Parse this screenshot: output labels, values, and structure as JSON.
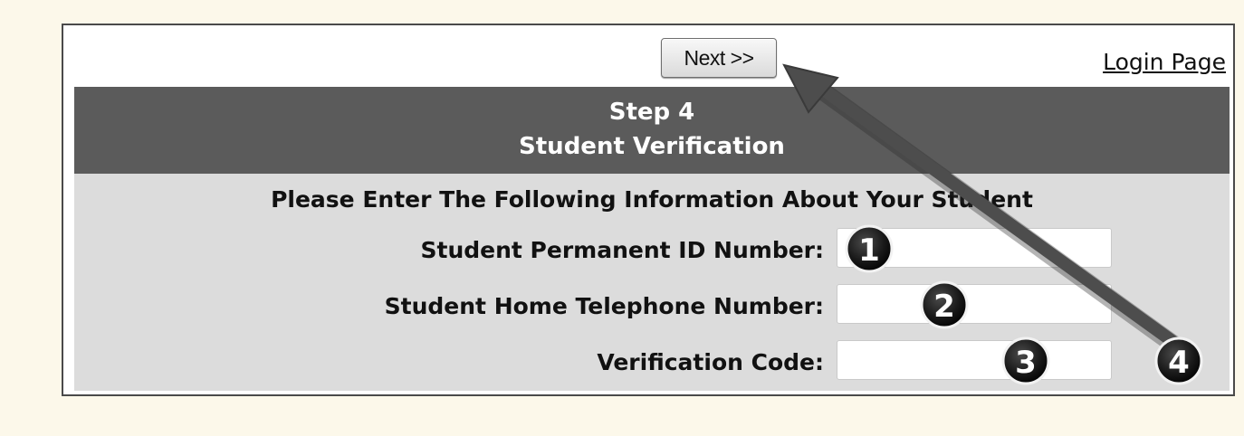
{
  "toolbar": {
    "next_label": "Next >>",
    "login_label": "Login Page"
  },
  "header": {
    "step": "Step 4",
    "title": "Student Verification"
  },
  "form": {
    "instruction": "Please Enter The Following Information About Your Student",
    "fields": [
      {
        "label": "Student Permanent ID Number:",
        "value": "",
        "placeholder": ""
      },
      {
        "label": "Student Home Telephone Number:",
        "value": "",
        "placeholder": ""
      },
      {
        "label": "Verification Code:",
        "value": "",
        "placeholder": ""
      }
    ]
  },
  "annotations": {
    "badges": [
      "1",
      "2",
      "3",
      "4"
    ],
    "badge_color": "#1a1a1a",
    "arrow_color": "#4d4d4d"
  }
}
